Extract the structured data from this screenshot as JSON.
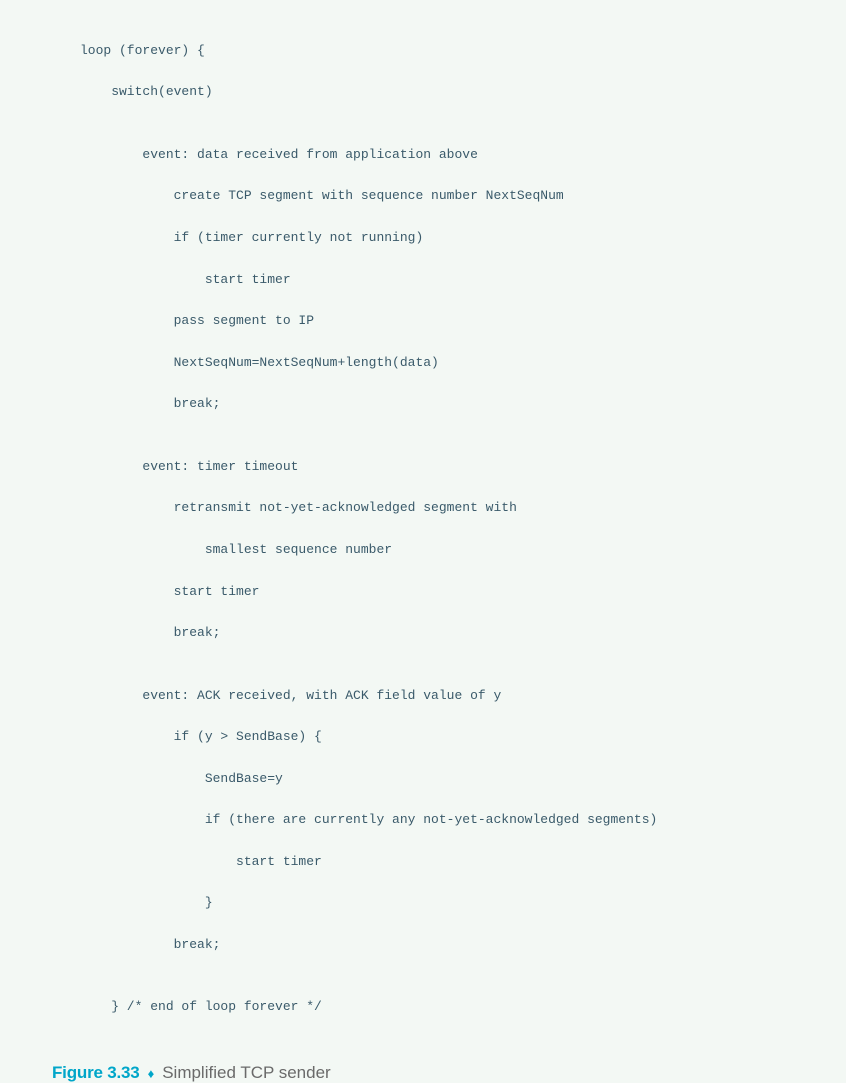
{
  "code": {
    "l0": "loop (forever) {",
    "l1": "    switch(event)",
    "l2": "",
    "l3": "        event: data received from application above",
    "l4": "            create TCP segment with sequence number NextSeqNum",
    "l5": "            if (timer currently not running)",
    "l6": "                start timer",
    "l7": "            pass segment to IP",
    "l8": "            NextSeqNum=NextSeqNum+length(data)",
    "l9": "            break;",
    "l10": "",
    "l11": "        event: timer timeout",
    "l12": "            retransmit not-yet-acknowledged segment with",
    "l13": "                smallest sequence number",
    "l14": "            start timer",
    "l15": "            break;",
    "l16": "",
    "l17": "        event: ACK received, with ACK field value of y",
    "l18": "            if (y > SendBase) {",
    "l19": "                SendBase=y",
    "l20": "                if (there are currently any not-yet-acknowledged segments)",
    "l21": "                    start timer",
    "l22": "                }",
    "l23": "            break;",
    "l24": "",
    "l25": "    } /* end of loop forever */"
  },
  "figure": {
    "label": "Figure 3.33",
    "separator": "♦",
    "text": "Simplified TCP sender"
  }
}
